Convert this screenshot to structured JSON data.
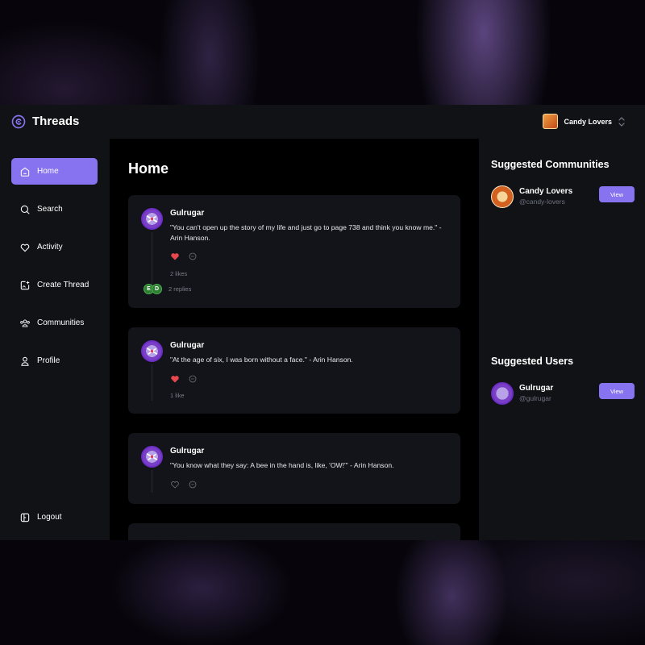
{
  "app": {
    "title": "Threads"
  },
  "organization": {
    "name": "Candy Lovers"
  },
  "nav": {
    "items": [
      {
        "label": "Home",
        "icon": "home-icon",
        "active": true
      },
      {
        "label": "Search",
        "icon": "search-icon"
      },
      {
        "label": "Activity",
        "icon": "heart-icon"
      },
      {
        "label": "Create Thread",
        "icon": "create-thread-icon"
      },
      {
        "label": "Communities",
        "icon": "communities-icon"
      },
      {
        "label": "Profile",
        "icon": "user-icon"
      }
    ],
    "logout": "Logout"
  },
  "main": {
    "title": "Home",
    "threads": [
      {
        "author": "Gulrugar",
        "text": "\"You can't open up the story of my life and just go to page 738 and think you know me.\" - Arin Hanson.",
        "liked": true,
        "likes": "2 likes",
        "reply_avatars": [
          "E",
          "D"
        ],
        "replies": "2 replies"
      },
      {
        "author": "Gulrugar",
        "text": "\"At the age of six, I was born without a face.\" - Arin Hanson.",
        "liked": true,
        "likes": "1 like"
      },
      {
        "author": "Gulrugar",
        "text": "\"You know what they say: A bee in the hand is, like, 'OW!'\" - Arin Hanson.",
        "liked": false
      }
    ]
  },
  "right": {
    "communities_title": "Suggested Communities",
    "communities": [
      {
        "name": "Candy Lovers",
        "handle": "@candy-lovers",
        "button": "View"
      }
    ],
    "users_title": "Suggested Users",
    "users": [
      {
        "name": "Gulrugar",
        "handle": "@gulrugar",
        "button": "View"
      }
    ]
  },
  "colors": {
    "accent": "#8773f0",
    "like": "#e5484d",
    "panel": "#101216",
    "card": "#121419"
  }
}
